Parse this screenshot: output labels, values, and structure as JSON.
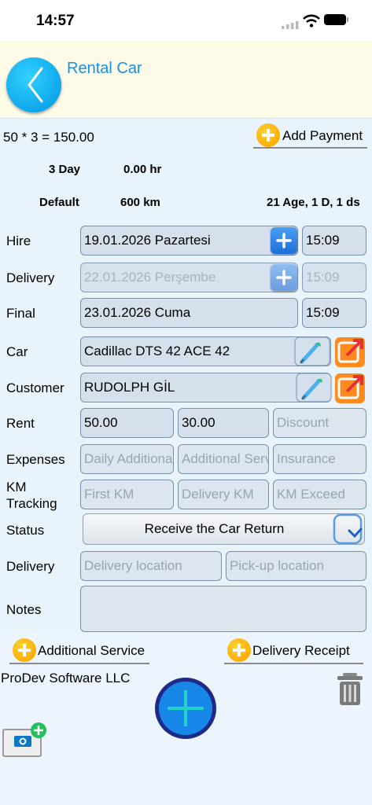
{
  "status_bar": {
    "time": "14:57"
  },
  "header": {
    "title": "Rental Car"
  },
  "summary": {
    "formula": "50 * 3 = 150.00",
    "add_payment_label": "Add Payment",
    "days": "3 Day",
    "hours": "0.00 hr",
    "plan": "Default",
    "km": "600 km",
    "driver_info": "21 Age, 1 D, 1 ds"
  },
  "form": {
    "hire": {
      "label": "Hire",
      "date": "19.01.2026 Pazartesi",
      "time": "15:09"
    },
    "delivery": {
      "label": "Delivery",
      "date": "22.01.2026 Perşembe",
      "time": "15:09"
    },
    "final": {
      "label": "Final",
      "date": "23.01.2026 Cuma",
      "time": "15:09"
    },
    "car": {
      "label": "Car",
      "value": "Cadillac DTS 42 ACE 42"
    },
    "customer": {
      "label": "Customer",
      "value": "RUDOLPH  GİL"
    },
    "rent": {
      "label": "Rent",
      "value1": "50.00",
      "value2": "30.00",
      "discount_placeholder": "Discount"
    },
    "expenses": {
      "label": "Expenses",
      "placeholder1": "Daily Additional",
      "placeholder2": "Additional Service",
      "placeholder3": "Insurance"
    },
    "km_tracking": {
      "label_line1": "KM",
      "label_line2": "Tracking",
      "placeholder1": "First KM",
      "placeholder2": "Delivery KM",
      "placeholder3": "KM Exceed"
    },
    "status": {
      "label": "Status",
      "value": "Receive the Car Return"
    },
    "delivery_loc": {
      "label": "Delivery",
      "placeholder1": "Delivery location",
      "placeholder2": "Pick-up location"
    },
    "notes": {
      "label": "Notes"
    }
  },
  "footer": {
    "additional_service_label": "Additional Service",
    "delivery_receipt_label": "Delivery Receipt",
    "company": "ProDev Software LLC"
  },
  "colors": {
    "accent": "#1a8fe6",
    "header_bg": "#fdfbe7",
    "page_bg": "#e9f3fb",
    "orange": "#ffae00",
    "field_bg": "#d5e0ec"
  },
  "icons": [
    "chevron-left-icon",
    "plus-icon",
    "pencil-icon",
    "external-link-icon",
    "chevron-down-icon",
    "trash-icon",
    "camera-icon",
    "wifi-icon",
    "signal-icon",
    "battery-icon"
  ]
}
